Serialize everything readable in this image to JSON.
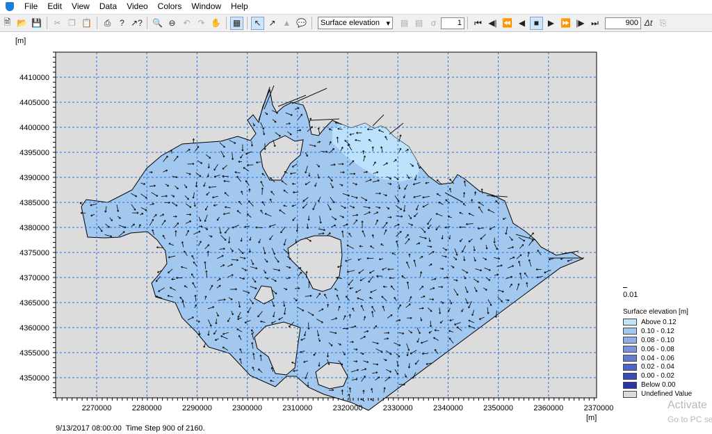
{
  "menu": [
    "File",
    "Edit",
    "View",
    "Data",
    "Video",
    "Colors",
    "Window",
    "Help"
  ],
  "toolbar": {
    "item_selector": "Surface elevation",
    "layer_value": "1",
    "step_value": "900",
    "dt_label": "Δt"
  },
  "map": {
    "y_unit": "[m]",
    "x_unit": "[m]",
    "x_ticks": [
      "2270000",
      "2280000",
      "2290000",
      "2300000",
      "2310000",
      "2320000",
      "2330000",
      "2340000",
      "2350000",
      "2360000",
      "2370000"
    ],
    "y_ticks": [
      "4410000",
      "4405000",
      "4400000",
      "4395000",
      "4390000",
      "4385000",
      "4380000",
      "4375000",
      "4370000",
      "4365000",
      "4360000",
      "4355000",
      "4350000"
    ],
    "background_color": "#dcdcdc",
    "water_color": "#a3c8f0",
    "high_color": "#bfe4fb",
    "grid_color": "#1f6fd8"
  },
  "vector_scale": {
    "label": "0.01"
  },
  "legend": {
    "title": "Surface elevation [m]",
    "items": [
      {
        "label": "Above 0.12",
        "color": "#bfe4fb"
      },
      {
        "label": "0.10 - 0.12",
        "color": "#a3c8f0"
      },
      {
        "label": "0.08 - 0.10",
        "color": "#8faee6"
      },
      {
        "label": "0.06 - 0.08",
        "color": "#7a95dc"
      },
      {
        "label": "0.04 - 0.06",
        "color": "#647cd2"
      },
      {
        "label": "0.02 - 0.04",
        "color": "#4f63c6"
      },
      {
        "label": "0.00 - 0.02",
        "color": "#3b4bba"
      },
      {
        "label": "Below 0.00",
        "color": "#2a34a6"
      },
      {
        "label": "Undefined Value",
        "color": "#dcdcdc"
      }
    ]
  },
  "status": {
    "text": "9/13/2017 08:00:00  Time Step 900 of 2160."
  },
  "watermark": {
    "line1": "Activate",
    "line2": "Go to PC se"
  }
}
